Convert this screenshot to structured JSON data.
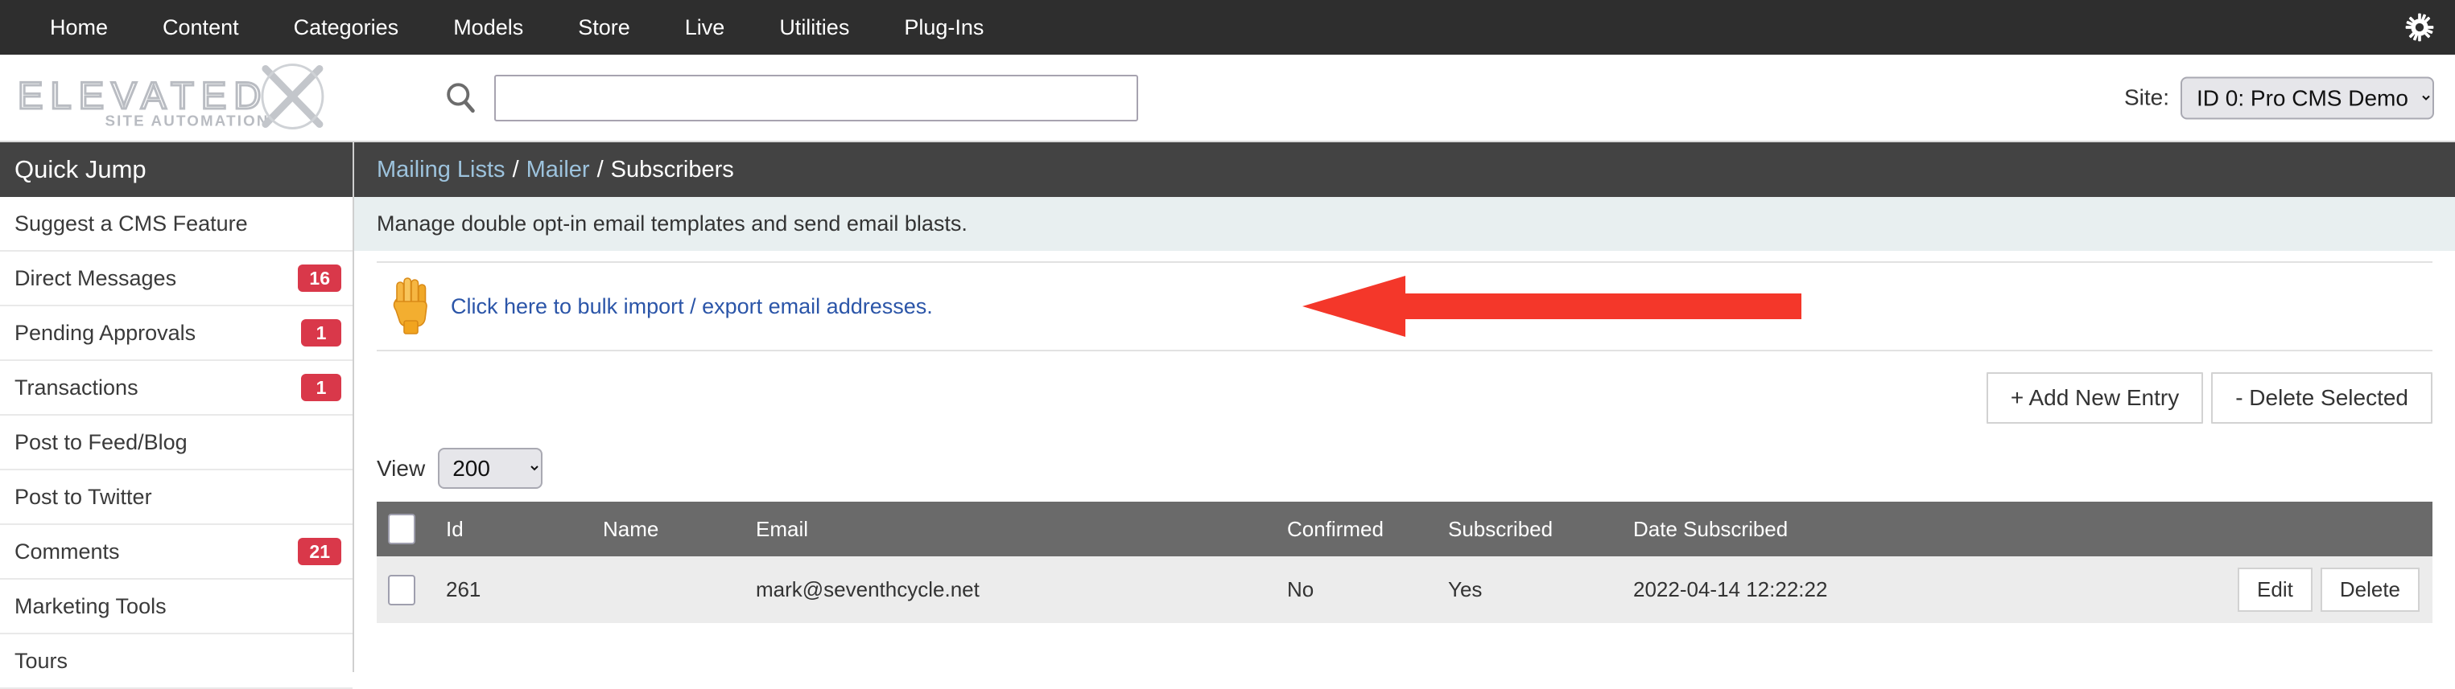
{
  "topnav": {
    "items": [
      {
        "label": "Home"
      },
      {
        "label": "Content"
      },
      {
        "label": "Categories"
      },
      {
        "label": "Models"
      },
      {
        "label": "Store"
      },
      {
        "label": "Live"
      },
      {
        "label": "Utilities"
      },
      {
        "label": "Plug-Ins"
      }
    ],
    "settings_icon": "gear-icon"
  },
  "utilbar": {
    "logo_primary": "ELEVATEDX",
    "logo_tagline": "SITE AUTOMATION",
    "search_icon": "search-icon",
    "search_value": "",
    "search_placeholder": "",
    "site_label": "Site:",
    "site_selected": "ID 0: Pro CMS Demo",
    "site_options": [
      "ID 0: Pro CMS Demo"
    ]
  },
  "sidebar": {
    "header": "Quick Jump",
    "items": [
      {
        "label": "Suggest a CMS Feature",
        "badge": ""
      },
      {
        "label": "Direct Messages",
        "badge": "16"
      },
      {
        "label": "Pending Approvals",
        "badge": "1"
      },
      {
        "label": "Transactions",
        "badge": "1"
      },
      {
        "label": "Post to Feed/Blog",
        "badge": ""
      },
      {
        "label": "Post to Twitter",
        "badge": ""
      },
      {
        "label": "Comments",
        "badge": "21"
      },
      {
        "label": "Marketing Tools",
        "badge": ""
      },
      {
        "label": "Tours",
        "badge": ""
      }
    ]
  },
  "main": {
    "breadcrumb": {
      "crumb1": "Mailing Lists",
      "sep1": "/",
      "crumb2": "Mailer",
      "sep2": "/",
      "current": "Subscribers"
    },
    "subtitle": "Manage double opt-in email templates and send email blasts.",
    "bulk": {
      "icon": "hand-icon",
      "link_text": "Click here to bulk import / export email addresses.",
      "annotation_arrow_color": "#f4372a"
    },
    "actions": {
      "add_label": "+ Add New Entry",
      "delete_label": "- Delete Selected"
    },
    "view": {
      "label": "View",
      "selected": "200",
      "options": [
        "200"
      ]
    },
    "table": {
      "columns": [
        "",
        "Id",
        "Name",
        "Email",
        "Confirmed",
        "Subscribed",
        "Date Subscribed",
        ""
      ],
      "rows": [
        {
          "id": "261",
          "name": "",
          "email": "mark@seventhcycle.net",
          "confirmed": "No",
          "subscribed": "Yes",
          "date_subscribed": "2022-04-14 12:22:22",
          "edit_label": "Edit",
          "delete_label": "Delete"
        }
      ]
    }
  },
  "colors": {
    "topnav_bg": "#2e2e2e",
    "header_bg": "#434343",
    "accent_link": "#2b55a8",
    "badge_red": "#d9384a",
    "arrow_red": "#f4372a",
    "subtitle_bg": "#e8eff0",
    "table_header_bg": "#6a6a6a"
  }
}
